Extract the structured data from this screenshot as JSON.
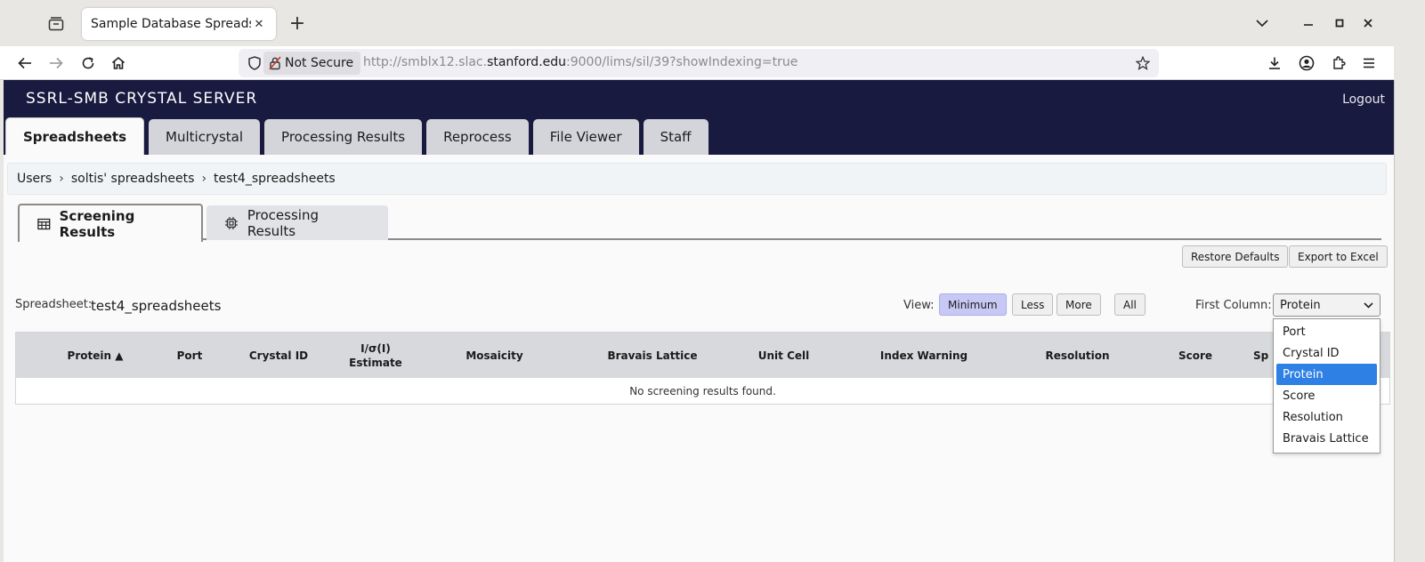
{
  "browser": {
    "tab_title": "Sample Database Spreadsheet",
    "url_security": "Not Secure",
    "url_prefix": "http://smblx12.slac.",
    "url_host": "stanford.edu",
    "url_suffix": ":9000/lims/sil/39?showIndexing=true"
  },
  "header": {
    "brand": "SSRL-SMB CRYSTAL SERVER",
    "logout": "Logout",
    "tabs": [
      "Spreadsheets",
      "Multicrystal",
      "Processing Results",
      "Reprocess",
      "File Viewer",
      "Staff"
    ]
  },
  "breadcrumb": [
    "Users",
    "soltis' spreadsheets",
    "test4_spreadsheets"
  ],
  "subtabs": [
    "Screening Results",
    "Processing Results"
  ],
  "actions": {
    "restore_defaults": "Restore Defaults",
    "export": "Export to Excel"
  },
  "spreadsheet": {
    "label": "Spreadsheet:",
    "name": "test4_spreadsheets"
  },
  "view": {
    "label": "View:",
    "options": [
      "Minimum",
      "Less",
      "More",
      "All"
    ],
    "selected": "Minimum"
  },
  "first_column": {
    "label": "First Column:",
    "value": "Protein",
    "options": [
      "Port",
      "Crystal ID",
      "Protein",
      "Score",
      "Resolution",
      "Bravais Lattice"
    ]
  },
  "table": {
    "columns": [
      "Protein ▲",
      "Port",
      "Crystal ID",
      "I/σ(I) Estimate",
      "Mosaicity",
      "Bravais Lattice",
      "Unit Cell",
      "Index Warning",
      "Resolution",
      "Score",
      "Sp"
    ],
    "empty_message": "No screening results found."
  }
}
